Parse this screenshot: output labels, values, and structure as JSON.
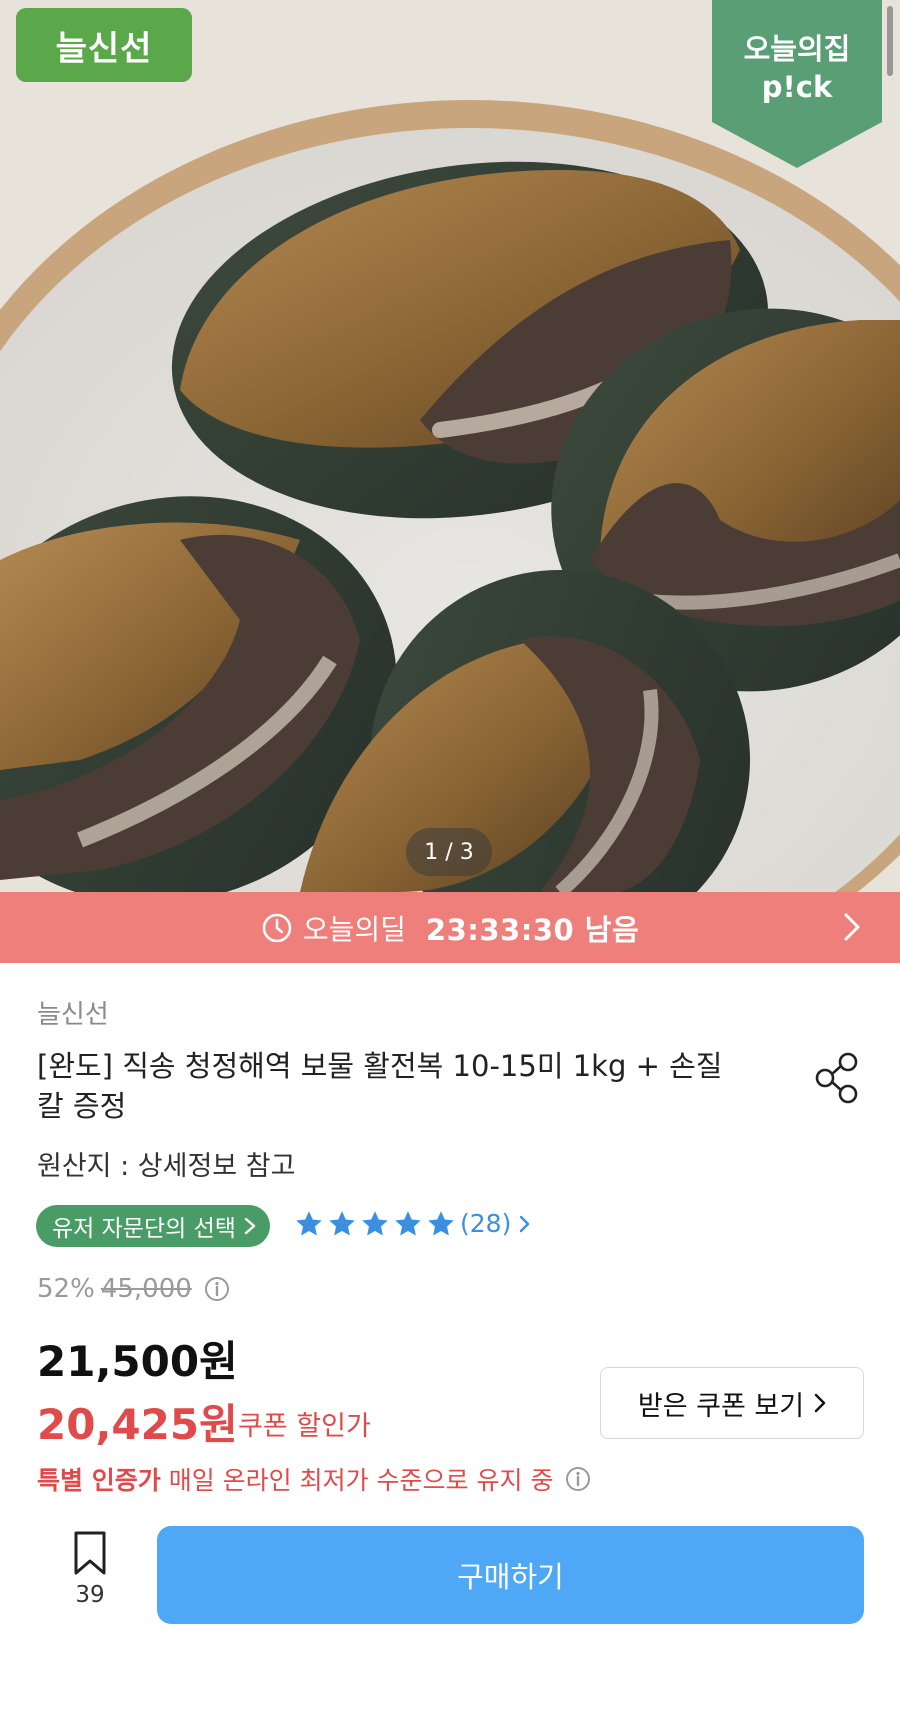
{
  "hero": {
    "brand_badge": "늘신선",
    "ribbon_line1": "오늘의집",
    "ribbon_line2": "p!ck",
    "pager": "1 / 3"
  },
  "deal": {
    "label": "오늘의딜",
    "timer": "23:33:30 남음"
  },
  "product": {
    "seller": "늘신선",
    "title": "[완도] 직송 청정해역 보물 활전복 10-15미 1kg + 손질칼 증정",
    "origin": "원산지 : 상세정보 참고",
    "advisor_badge": "유저 자문단의 선택",
    "rating_stars": 5,
    "review_count": "(28)",
    "discount_rate": "52%",
    "original_price": "45,000",
    "price": "21,500원",
    "coupon_price": "20,425원",
    "coupon_label": "쿠폰 할인가",
    "coupon_button": "받은 쿠폰 보기",
    "cert_strong": "특별 인증가",
    "cert_text": "매일 온라인 최저가 수준으로 유지 중"
  },
  "bottom": {
    "bookmark_count": "39",
    "buy_button": "구매하기"
  },
  "colors": {
    "brand_green": "#5aa84a",
    "ribbon_green": "#5a9e75",
    "deal_bar": "#ee7f7b",
    "advisor_green": "#4a9c67",
    "star_blue": "#3b8fe0",
    "sale_red": "#e04a4a",
    "buy_blue": "#4ea8f5"
  }
}
